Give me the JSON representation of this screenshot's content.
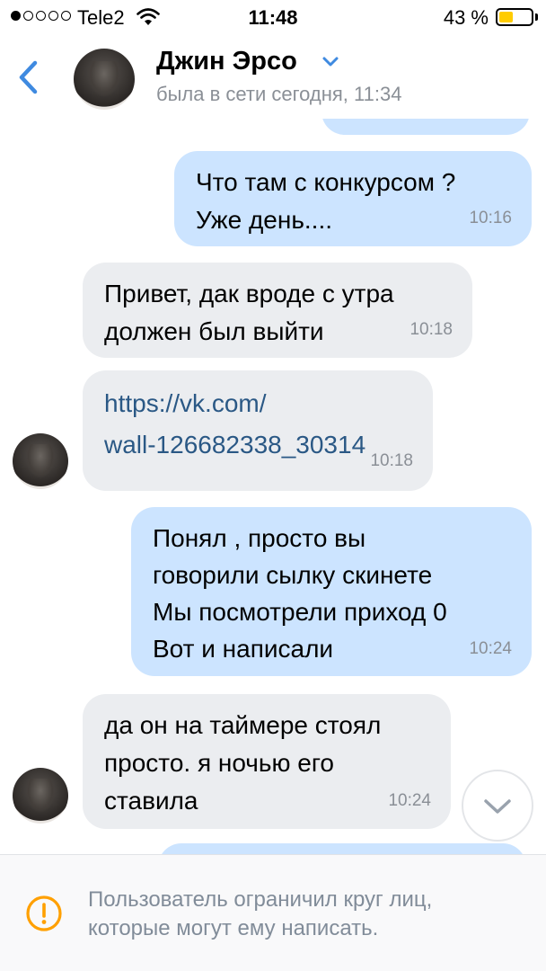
{
  "status_bar": {
    "carrier": "Tele2",
    "time": "11:48",
    "battery": "43 %",
    "battery_level": 0.43,
    "signal_bars": 1,
    "icons": [
      "signal-icon",
      "wifi-icon",
      "battery-icon"
    ]
  },
  "header": {
    "name": "Джин Эрсо",
    "status": "была в сети сегодня, 11:34",
    "icons": [
      "back-icon",
      "chevron-down-icon"
    ],
    "accent_color": "#3f8ae0"
  },
  "messages": [
    {
      "direction": "out",
      "text": "Что там с конкурсом ?\nУже день....",
      "time": "10:16"
    },
    {
      "direction": "in",
      "text": "Привет, дак вроде с утра\nдолжен был выйти",
      "time": "10:18"
    },
    {
      "direction": "in",
      "text": "https://vk.com/\nwall-126682338_30314",
      "time": "10:18",
      "is_link": true
    },
    {
      "direction": "out",
      "text": "Понял , просто вы\nговорили сылку скинете\nМы посмотрели приход 0\nВот и написали",
      "time": "10:24"
    },
    {
      "direction": "in",
      "text": "да он на таймере стоял\nпросто. я ночью его\nставила",
      "time": "10:24"
    }
  ],
  "colors": {
    "outgoing_bubble": "#cce4ff",
    "incoming_bubble": "#ebedf0",
    "link": "#2a5885",
    "warning": "#ffa000"
  },
  "footer": {
    "icon": "warning-icon",
    "text": "Пользователь ограничил круг лиц,\nкоторые могут ему написать."
  }
}
